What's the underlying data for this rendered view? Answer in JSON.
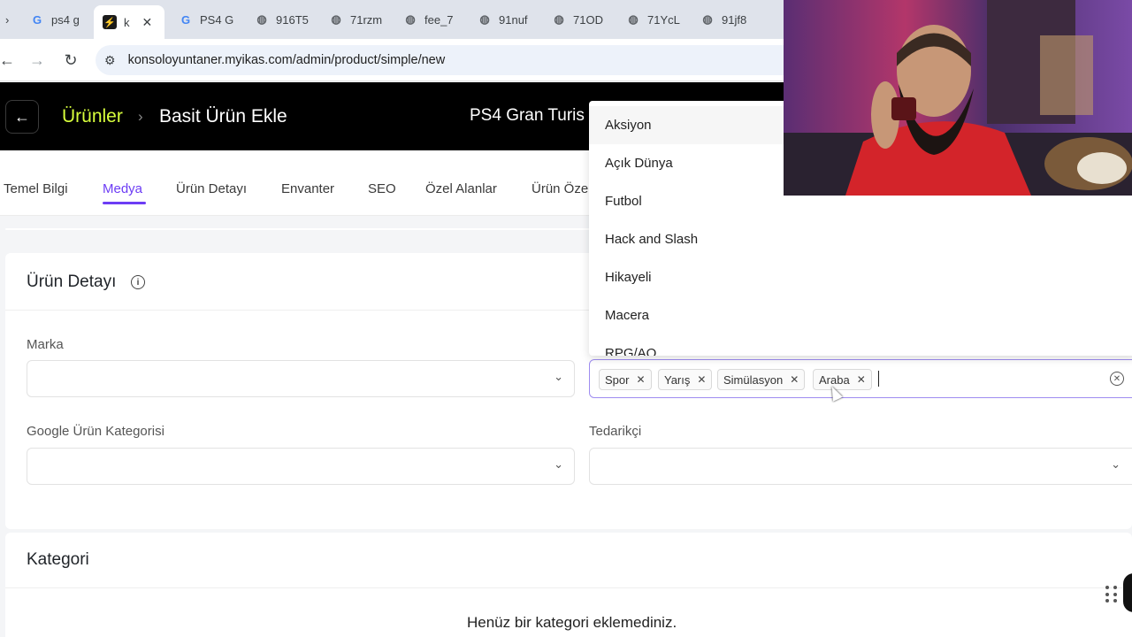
{
  "browser": {
    "tabs": [
      {
        "icon": "google-icon",
        "label": "ps4 g"
      },
      {
        "icon": "ikas-icon",
        "label": "k",
        "active": true
      },
      {
        "icon": "google-icon",
        "label": "PS4 G"
      },
      {
        "icon": "globe-icon",
        "label": "916T5"
      },
      {
        "icon": "globe-icon",
        "label": "71rzm"
      },
      {
        "icon": "globe-icon",
        "label": "fee_7"
      },
      {
        "icon": "globe-icon",
        "label": "91nuf"
      },
      {
        "icon": "globe-icon",
        "label": "71OD"
      },
      {
        "icon": "globe-icon",
        "label": "71YcL"
      },
      {
        "icon": "globe-icon",
        "label": "91jf8"
      }
    ],
    "url": "konsoloyuntaner.myikas.com/admin/product/simple/new"
  },
  "header": {
    "breadcrumb_root": "Ürünler",
    "breadcrumb_current": "Basit Ürün Ekle",
    "product_name": "PS4 Gran Turis",
    "accent_color": "#d8ff3c"
  },
  "nav": {
    "tabs": [
      "Temel Bilgi",
      "Medya",
      "Ürün Detayı",
      "Envanter",
      "SEO",
      "Özel Alanlar",
      "Ürün Öze"
    ],
    "active": "Medya",
    "active_color": "#6d3df5"
  },
  "detail": {
    "title": "Ürün Detayı",
    "brand_label": "Marka",
    "google_category_label": "Google Ürün Kategorisi",
    "supplier_label": "Tedarikçi",
    "tags": [
      "Spor",
      "Yarış",
      "Simülasyon",
      "Araba"
    ],
    "dropdown_options": [
      "Aksiyon",
      "Açık Dünya",
      "Futbol",
      "Hack and Slash",
      "Hikayeli",
      "Macera",
      "RPG/AO"
    ]
  },
  "category": {
    "title": "Kategori",
    "empty_message": "Henüz bir kategori eklemediniz."
  }
}
